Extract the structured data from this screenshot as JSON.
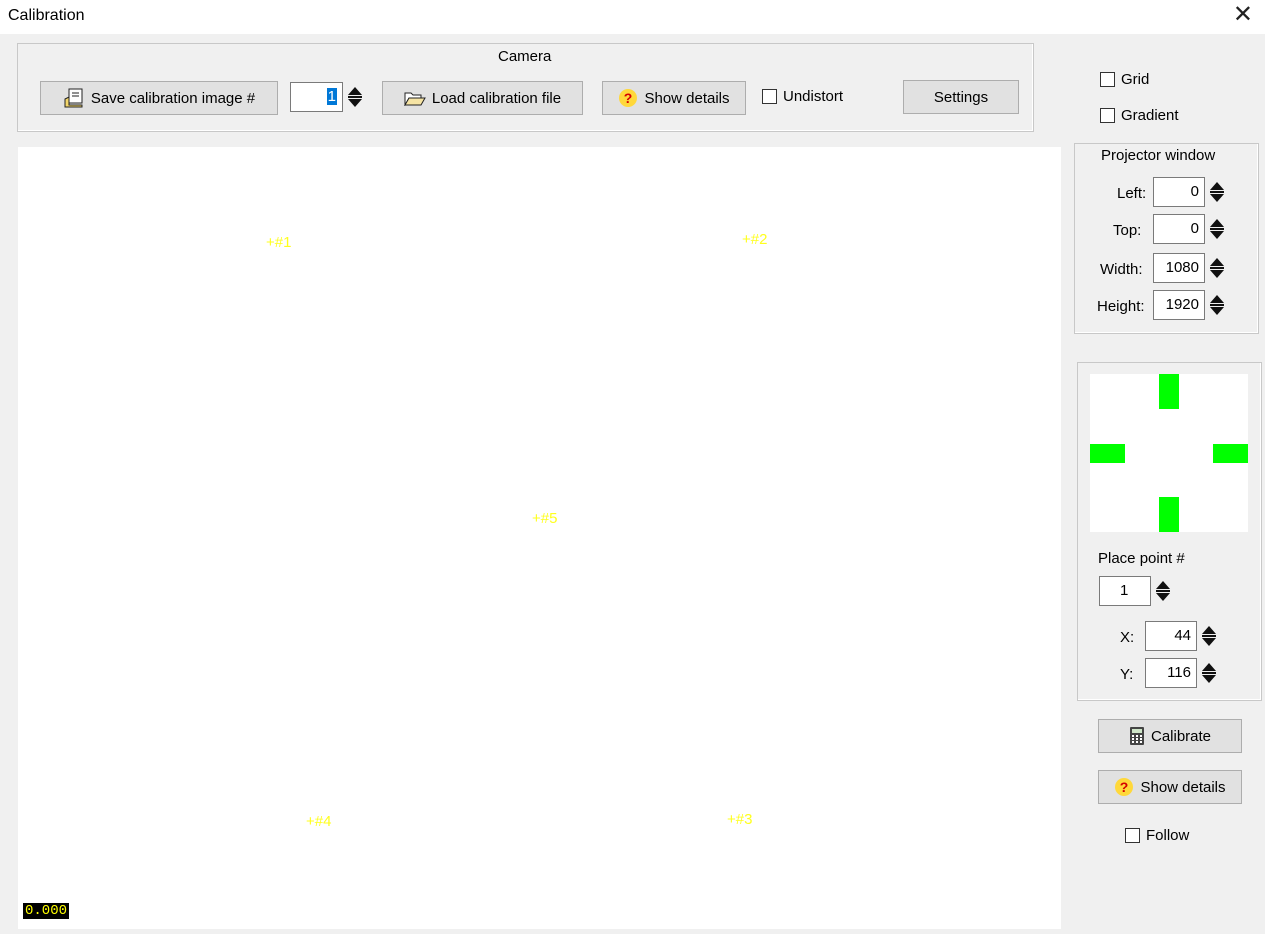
{
  "window": {
    "title": "Calibration",
    "close_glyph": "✕"
  },
  "camera": {
    "group_label": "Camera",
    "save_button_label": "Save calibration image #",
    "image_number": "1",
    "load_button_label": "Load calibration file",
    "show_details_label": "Show details",
    "undistort_label": "Undistort",
    "undistort_checked": false,
    "settings_label": "Settings"
  },
  "options": {
    "grid_label": "Grid",
    "grid_checked": false,
    "gradient_label": "Gradient",
    "gradient_checked": false
  },
  "projector": {
    "group_label": "Projector window",
    "left_label": "Left:",
    "left_value": "0",
    "top_label": "Top:",
    "top_value": "0",
    "width_label": "Width:",
    "width_value": "1080",
    "height_label": "Height:",
    "height_value": "1920"
  },
  "placement": {
    "preview_color": "#00ff00",
    "place_point_label": "Place point #",
    "point_number": "1",
    "x_label": "X:",
    "x_value": "44",
    "y_label": "Y:",
    "y_value": "116"
  },
  "actions": {
    "calibrate_label": "Calibrate",
    "show_details_label": "Show details",
    "follow_label": "Follow",
    "follow_checked": false
  },
  "canvas": {
    "marker_color": "#ffff1e",
    "markers": [
      "+#1",
      "+#2",
      "+#5",
      "+#4",
      "+#3"
    ],
    "readout": "0.000"
  }
}
